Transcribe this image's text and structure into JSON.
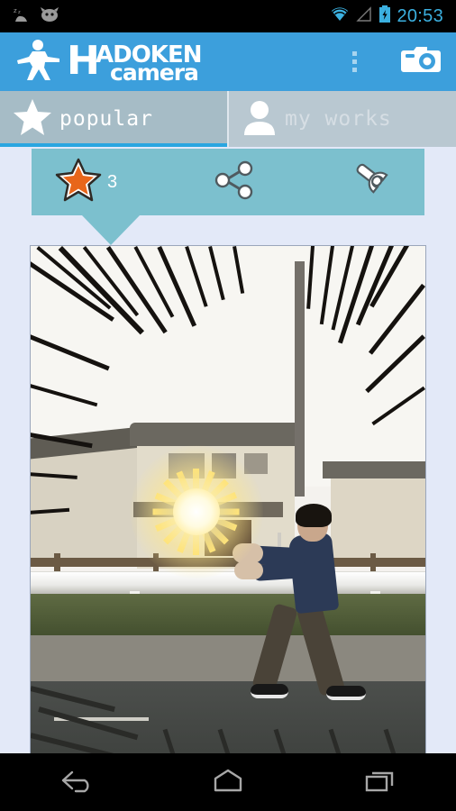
{
  "statusbar": {
    "time": "20:53",
    "notification_icons": [
      "alarm-snooze-icon",
      "cyanogenmod-mascot-icon"
    ],
    "system_icons": [
      "wifi-icon",
      "cell-signal-icon",
      "battery-charging-icon"
    ],
    "accent_color": "#3bb0e0"
  },
  "appbar": {
    "logo_letter": "H",
    "logo_word": "ADOKEN",
    "logo_sub": "camera",
    "logo_figure_icon": "hadoken-figure-icon",
    "overflow_label": "overflow-menu",
    "camera_label": "camera-button",
    "background_color": "#3c9fdc"
  },
  "tabs": [
    {
      "label": "popular",
      "icon": "star-icon",
      "active": true
    },
    {
      "label": "my works",
      "icon": "person-icon",
      "active": false
    }
  ],
  "actions": {
    "favorite": {
      "icon": "star-icon",
      "count": "3",
      "color": "#e8661a"
    },
    "share": {
      "icon": "share-icon"
    },
    "tools": {
      "icon": "wrench-icon"
    },
    "background_color": "#7cc0ce"
  },
  "photo": {
    "alt": "man performing hadoken pose with glowing energy ball on a japanese residential street",
    "effect": "hadoken-energy-ball",
    "manga_speed_lines": true
  },
  "navbar": {
    "buttons": [
      {
        "label": "back",
        "icon": "back-arrow-icon"
      },
      {
        "label": "home",
        "icon": "home-icon"
      },
      {
        "label": "recents",
        "icon": "recents-icon"
      }
    ]
  }
}
